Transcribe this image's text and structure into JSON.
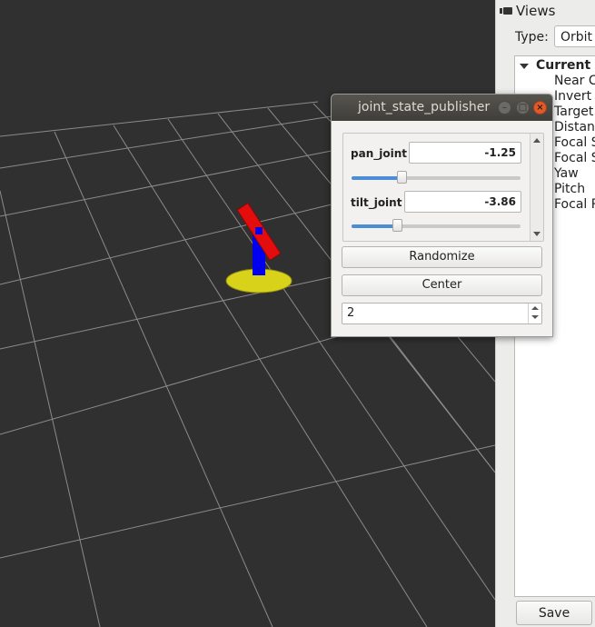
{
  "views_panel": {
    "title": "Views",
    "type_label": "Type:",
    "type_value": "Orbit",
    "tree_header": "Current V",
    "tree_items": [
      "Near C",
      "Invert Z",
      "Target",
      "Distanc",
      "Focal S",
      "Focal S",
      "Yaw",
      "Pitch",
      "Focal P"
    ],
    "save_label": "Save"
  },
  "jsp_window": {
    "title": "joint_state_publisher",
    "joints": [
      {
        "label": "pan_joint",
        "value": "-1.25",
        "fraction": 0.3
      },
      {
        "label": "tilt_joint",
        "value": "-3.86",
        "fraction": 0.27
      }
    ],
    "randomize_label": "Randomize",
    "center_label": "Center",
    "spin_value": "2"
  },
  "colors": {
    "viewport_bg": "#303030",
    "grid_line": "#8a8a8a",
    "slider_accent": "#4a8fd6",
    "robot_base": "#d8d21b",
    "robot_pan": "#0000ee",
    "robot_tilt": "#e30d0d",
    "close_button": "#e05a2b"
  }
}
